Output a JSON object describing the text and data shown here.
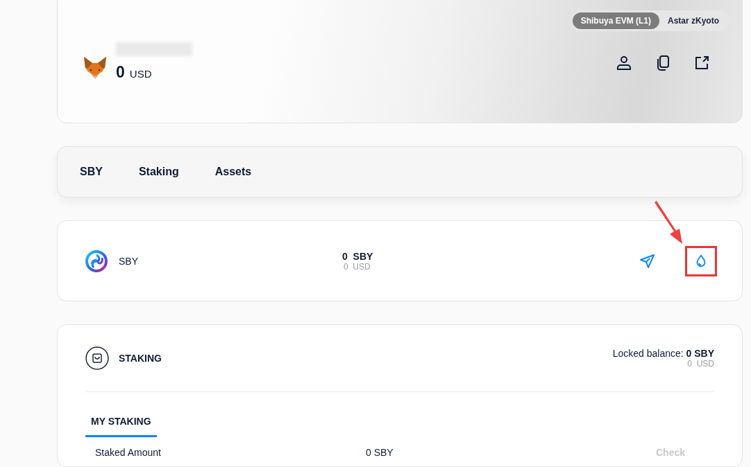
{
  "header": {
    "balance": "0",
    "currency": "USD",
    "networks": [
      {
        "label": "Shibuya EVM (L1)",
        "selected": true
      },
      {
        "label": "Astar zKyoto",
        "selected": false
      }
    ]
  },
  "tabs": [
    {
      "label": "SBY"
    },
    {
      "label": "Staking"
    },
    {
      "label": "Assets"
    }
  ],
  "token": {
    "name": "SBY",
    "amount": "0",
    "symbol": "SBY",
    "usd_amount": "0",
    "usd": "USD",
    "faucet_highlighted": true
  },
  "staking": {
    "title": "STAKING",
    "locked_label": "Locked balance:",
    "locked_amount": "0 SBY",
    "locked_usd_amount": "0",
    "locked_usd": "USD",
    "tabs": [
      {
        "label": "MY STAKING",
        "selected": true
      }
    ],
    "row": {
      "label": "Staked Amount",
      "value": "0 SBY",
      "action": "Check"
    }
  }
}
